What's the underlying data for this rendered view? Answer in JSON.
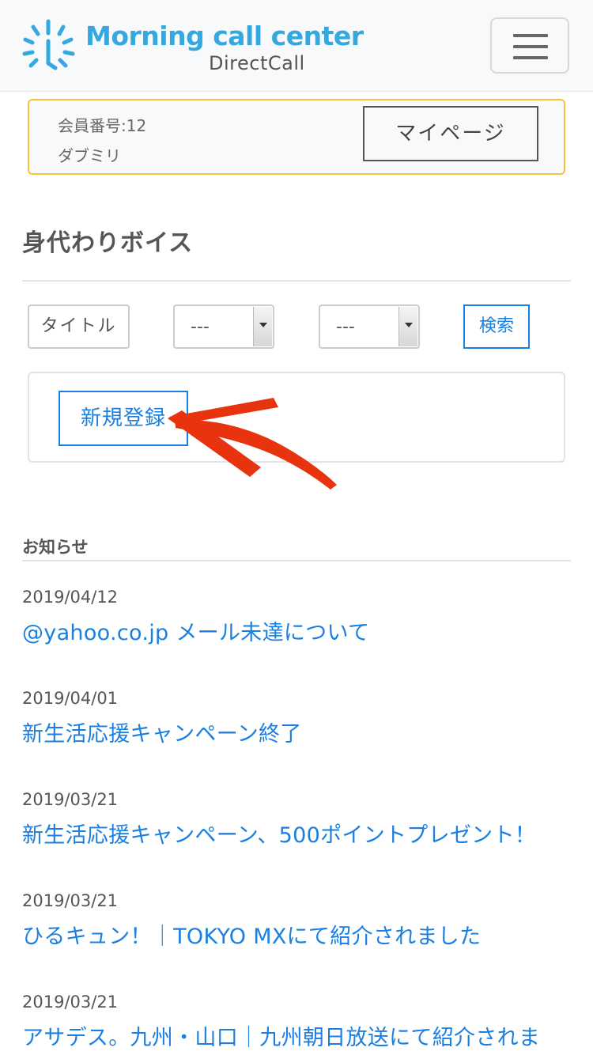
{
  "header": {
    "logo_main": "Morning call center",
    "logo_sub": "DirectCall",
    "logo_icon": "sunburst-clock-icon",
    "menu_icon": "hamburger-icon"
  },
  "member": {
    "number": "会員番号:12",
    "name": "ダブミリ",
    "mypage_label": "マイページ"
  },
  "page": {
    "title": "身代わりボイス"
  },
  "filters": {
    "title_label": "タイトル",
    "select1_value": "---",
    "select2_value": "---",
    "search_label": "検索"
  },
  "register": {
    "label": "新規登録"
  },
  "annotation": {
    "arrow_color": "#e8330f"
  },
  "news": {
    "heading": "お知らせ",
    "items": [
      {
        "date": "2019/04/12",
        "title": "@yahoo.co.jp メール未達について"
      },
      {
        "date": "2019/04/01",
        "title": "新生活応援キャンペーン終了"
      },
      {
        "date": "2019/03/21",
        "title": "新生活応援キャンペーン、500ポイントプレゼント！"
      },
      {
        "date": "2019/03/21",
        "title": "ひるキュン！｜TOKYO MXにて紹介されました"
      },
      {
        "date": "2019/03/21",
        "title": "アサデス。九州・山口｜九州朝日放送にて紹介されま"
      }
    ]
  },
  "colors": {
    "brand": "#35a8e0",
    "link": "#1a7fe0",
    "member_border": "#f5c33a"
  }
}
